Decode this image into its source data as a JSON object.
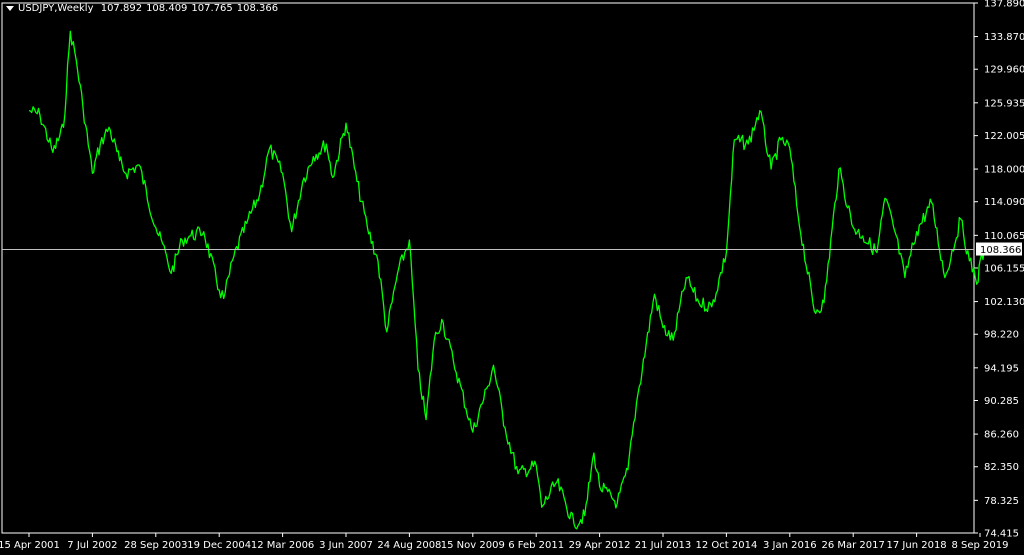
{
  "title": {
    "symbol": "USDJPY,Weekly",
    "open": "107.892",
    "high": "108.409",
    "low": "107.765",
    "close": "108.366"
  },
  "colors": {
    "background": "#000000",
    "series": "#00ff00",
    "axis": "#ffffff",
    "price_line": "#c0c0c0"
  },
  "chart_data": {
    "type": "line",
    "title": "USDJPY,Weekly",
    "current_price": 108.366,
    "ylim": [
      74.415,
      137.89
    ],
    "y_ticks": [
      "137.890",
      "133.870",
      "129.960",
      "125.935",
      "122.005",
      "118.000",
      "114.090",
      "110.065",
      "106.155",
      "102.130",
      "98.220",
      "94.195",
      "90.285",
      "86.260",
      "82.350",
      "78.325",
      "74.415"
    ],
    "x_ticks": [
      "15 Apr 2001",
      "7 Jul 2002",
      "28 Sep 2003",
      "19 Dec 2004",
      "12 Mar 2006",
      "3 Jun 2007",
      "24 Aug 2008",
      "15 Nov 2009",
      "6 Feb 2011",
      "29 Apr 2012",
      "21 Jul 2013",
      "12 Oct 2014",
      "3 Jan 2016",
      "26 Mar 2017",
      "17 Jun 2018",
      "8 Sep 2019"
    ],
    "series": [
      {
        "values": [
          [
            "2001-04-15",
            125.0
          ],
          [
            "2001-07-01",
            124.5
          ],
          [
            "2001-10-01",
            120.0
          ],
          [
            "2001-12-15",
            123.0
          ],
          [
            "2002-02-01",
            134.5
          ],
          [
            "2002-03-15",
            131.0
          ],
          [
            "2002-05-01",
            125.5
          ],
          [
            "2002-07-07",
            117.5
          ],
          [
            "2002-09-01",
            121.0
          ],
          [
            "2002-11-01",
            123.0
          ],
          [
            "2003-01-15",
            119.0
          ],
          [
            "2003-03-01",
            117.5
          ],
          [
            "2003-06-01",
            118.5
          ],
          [
            "2003-09-28",
            111.0
          ],
          [
            "2003-12-15",
            107.5
          ],
          [
            "2004-01-15",
            105.5
          ],
          [
            "2004-04-01",
            109.5
          ],
          [
            "2004-06-01",
            110.0
          ],
          [
            "2004-09-01",
            110.5
          ],
          [
            "2004-12-19",
            103.5
          ],
          [
            "2005-01-20",
            102.5
          ],
          [
            "2005-04-01",
            107.5
          ],
          [
            "2005-07-01",
            111.5
          ],
          [
            "2005-10-01",
            115.0
          ],
          [
            "2005-12-10",
            120.5
          ],
          [
            "2006-03-12",
            117.5
          ],
          [
            "2006-05-15",
            110.5
          ],
          [
            "2006-08-01",
            116.5
          ],
          [
            "2006-10-15",
            119.5
          ],
          [
            "2007-01-15",
            121.0
          ],
          [
            "2007-03-01",
            117.0
          ],
          [
            "2007-06-03",
            123.5
          ],
          [
            "2007-08-20",
            116.5
          ],
          [
            "2007-11-01",
            111.0
          ],
          [
            "2008-01-15",
            107.0
          ],
          [
            "2008-03-17",
            98.5
          ],
          [
            "2008-06-01",
            105.5
          ],
          [
            "2008-08-24",
            109.5
          ],
          [
            "2008-10-24",
            94.0
          ],
          [
            "2008-12-20",
            88.0
          ],
          [
            "2009-02-15",
            97.5
          ],
          [
            "2009-04-10",
            100.0
          ],
          [
            "2009-07-01",
            95.0
          ],
          [
            "2009-11-15",
            86.5
          ],
          [
            "2010-03-01",
            92.0
          ],
          [
            "2010-04-10",
            94.5
          ],
          [
            "2010-07-01",
            87.0
          ],
          [
            "2010-10-01",
            81.5
          ],
          [
            "2011-02-06",
            82.5
          ],
          [
            "2011-03-17",
            77.5
          ],
          [
            "2011-07-01",
            80.5
          ],
          [
            "2011-10-31",
            75.5
          ],
          [
            "2012-01-15",
            76.5
          ],
          [
            "2012-03-20",
            84.0
          ],
          [
            "2012-04-29",
            80.0
          ],
          [
            "2012-09-01",
            78.0
          ],
          [
            "2012-11-15",
            82.0
          ],
          [
            "2013-01-15",
            90.0
          ],
          [
            "2013-05-22",
            103.0
          ],
          [
            "2013-07-21",
            99.0
          ],
          [
            "2013-10-01",
            97.5
          ],
          [
            "2014-01-01",
            105.0
          ],
          [
            "2014-04-01",
            102.0
          ],
          [
            "2014-07-01",
            101.5
          ],
          [
            "2014-10-12",
            108.0
          ],
          [
            "2014-12-07",
            121.5
          ],
          [
            "2015-03-15",
            121.0
          ],
          [
            "2015-06-05",
            125.0
          ],
          [
            "2015-08-24",
            118.0
          ],
          [
            "2015-11-01",
            121.5
          ],
          [
            "2016-01-03",
            120.5
          ],
          [
            "2016-03-01",
            112.5
          ],
          [
            "2016-06-24",
            101.0
          ],
          [
            "2016-09-01",
            102.0
          ],
          [
            "2016-12-15",
            118.0
          ],
          [
            "2017-03-26",
            111.0
          ],
          [
            "2017-06-01",
            110.0
          ],
          [
            "2017-09-10",
            108.0
          ],
          [
            "2017-11-06",
            114.5
          ],
          [
            "2018-01-15",
            110.5
          ],
          [
            "2018-03-26",
            105.0
          ],
          [
            "2018-06-17",
            110.5
          ],
          [
            "2018-10-01",
            114.0
          ],
          [
            "2019-01-03",
            105.0
          ],
          [
            "2019-04-25",
            112.0
          ],
          [
            "2019-06-25",
            107.0
          ],
          [
            "2019-08-26",
            104.5
          ],
          [
            "2019-09-08",
            107.0
          ],
          [
            "2019-10-20",
            108.37
          ]
        ]
      }
    ],
    "grid": false,
    "legend": "none"
  }
}
